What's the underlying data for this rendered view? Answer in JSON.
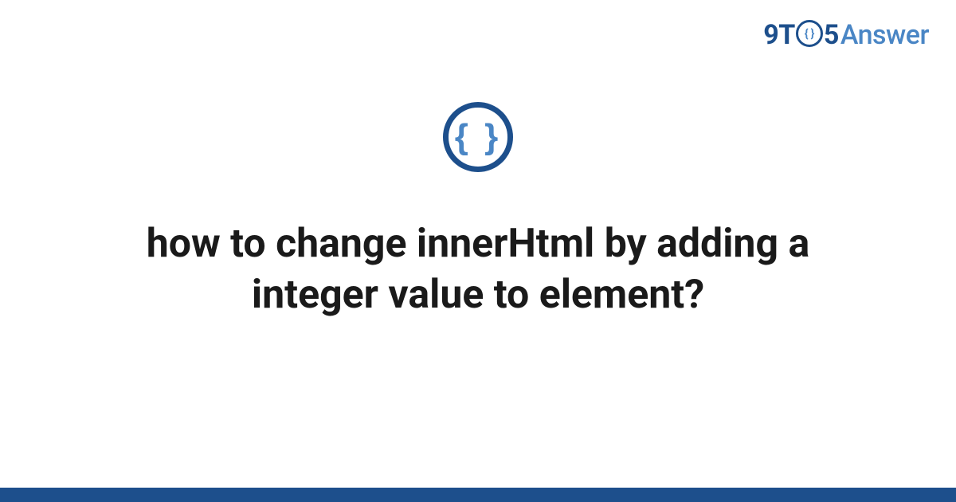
{
  "brand": {
    "part1": "9T",
    "circle_inner": "{ }",
    "part2": "5",
    "part3": "Answer"
  },
  "topic_icon": {
    "symbol": "{ }"
  },
  "question": {
    "title": "how to change innerHtml by adding a integer value to element?"
  },
  "colors": {
    "primary_dark": "#1d4f8c",
    "primary_light": "#4a86c5"
  }
}
